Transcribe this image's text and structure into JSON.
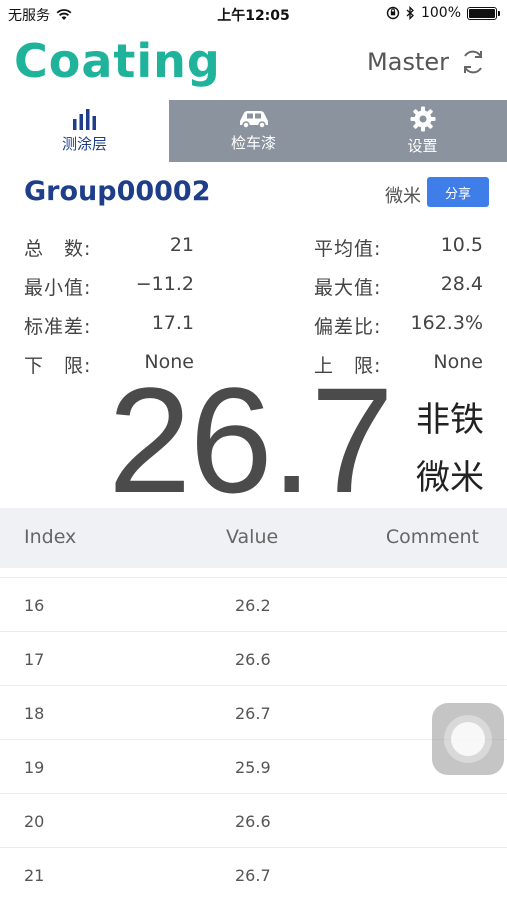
{
  "status_bar": {
    "carrier": "无服务",
    "time": "上午12:05",
    "battery_percent": "100%",
    "icons": [
      "wifi-icon",
      "orientation-lock-icon",
      "bluetooth-icon",
      "battery-icon"
    ]
  },
  "header": {
    "logo": "Coating",
    "mode_label": "Master",
    "mode_icon": "sync-icon",
    "brand_color": "#1fb39b"
  },
  "tabs": [
    {
      "label": "测涂层",
      "icon": "bar-chart-icon",
      "active": true
    },
    {
      "label": "检车漆",
      "icon": "car-icon",
      "active": false
    },
    {
      "label": "设置",
      "icon": "gear-icon",
      "active": false
    }
  ],
  "group": {
    "name": "Group00002",
    "unit": "微米",
    "share_label": "分享"
  },
  "stats": {
    "total_label": "总　数:",
    "total_value": "21",
    "mean_label": "平均值:",
    "mean_value": "10.5",
    "min_label": "最小值:",
    "min_value": "−11.2",
    "max_label": "最大值:",
    "max_value": "28.4",
    "std_label": "标准差:",
    "std_value": "17.1",
    "dev_label": "偏差比:",
    "dev_value": "162.3%",
    "lower_label": "下　限:",
    "lower_value": "None",
    "upper_label": "上　限:",
    "upper_value": "None"
  },
  "reading": {
    "value": "26.7",
    "type": "非铁",
    "unit": "微米"
  },
  "table": {
    "headers": {
      "index": "Index",
      "value": "Value",
      "comment": "Comment"
    },
    "rows": [
      {
        "index": "16",
        "value": "26.2",
        "comment": ""
      },
      {
        "index": "17",
        "value": "26.6",
        "comment": ""
      },
      {
        "index": "18",
        "value": "26.7",
        "comment": ""
      },
      {
        "index": "19",
        "value": "25.9",
        "comment": ""
      },
      {
        "index": "20",
        "value": "26.6",
        "comment": ""
      },
      {
        "index": "21",
        "value": "26.7",
        "comment": ""
      }
    ]
  }
}
